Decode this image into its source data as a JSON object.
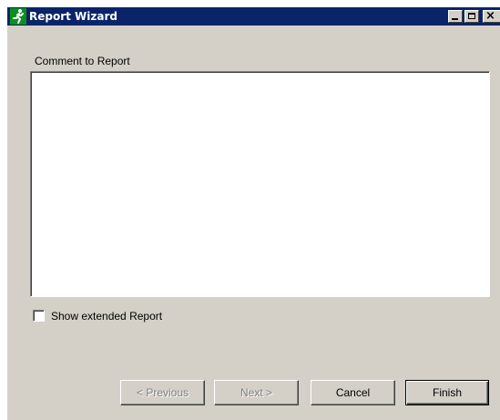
{
  "window": {
    "title": "Report Wizard",
    "icon": "running-man-icon",
    "controls": {
      "minimize_icon": "minimize-icon",
      "maximize_icon": "maximize-icon",
      "close_glyph": "×"
    }
  },
  "comment": {
    "label": "Comment to Report",
    "value": ""
  },
  "extended_report": {
    "label": "Show extended Report",
    "checked": false
  },
  "buttons": {
    "previous": "< Previous",
    "next": "Next >",
    "cancel": "Cancel",
    "finish": "Finish"
  },
  "colors": {
    "titlebar": "#0a246a",
    "face": "#d4d0c8",
    "icon_green": "#0f8f1f"
  }
}
